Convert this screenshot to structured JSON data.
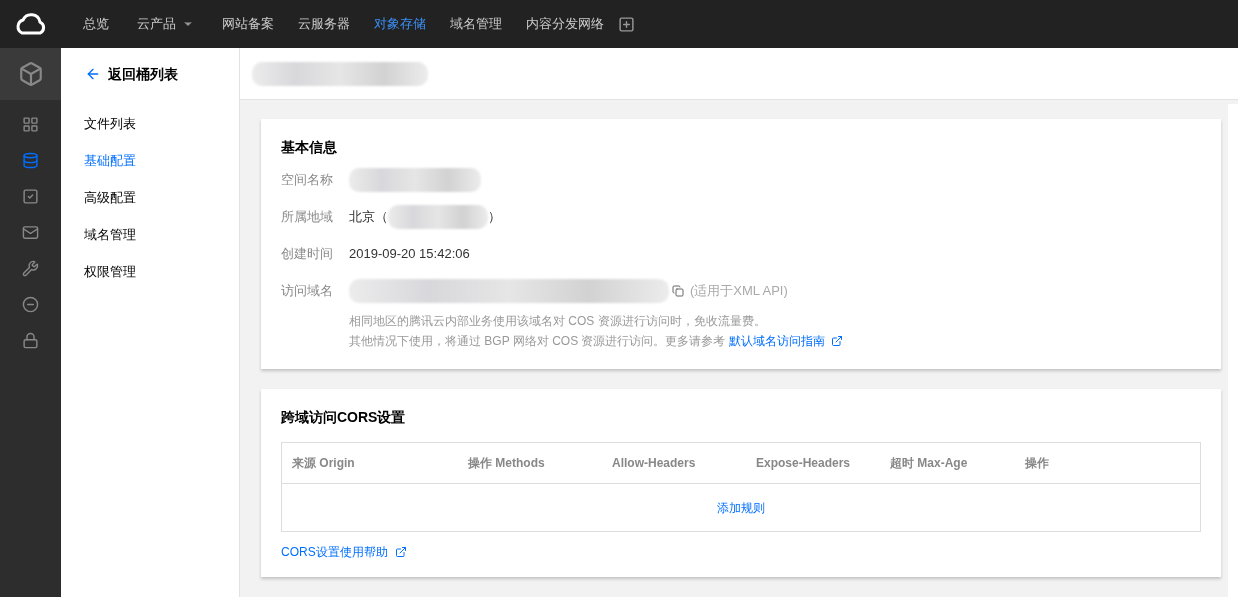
{
  "top_nav": [
    {
      "label": "总览",
      "selected": false,
      "dropdown": false
    },
    {
      "label": "云产品",
      "selected": false,
      "dropdown": true
    },
    {
      "label": "网站备案",
      "selected": false,
      "dropdown": false
    },
    {
      "label": "云服务器",
      "selected": false,
      "dropdown": false
    },
    {
      "label": "对象存储",
      "selected": true,
      "dropdown": false
    },
    {
      "label": "域名管理",
      "selected": false,
      "dropdown": false
    },
    {
      "label": "内容分发网络",
      "selected": false,
      "dropdown": false
    }
  ],
  "rail": [
    {
      "kind": "grid",
      "selected": false
    },
    {
      "kind": "database",
      "selected": true
    },
    {
      "kind": "check",
      "selected": false
    },
    {
      "kind": "mail",
      "selected": false
    },
    {
      "kind": "wrench",
      "selected": false
    },
    {
      "kind": "minus",
      "selected": false
    },
    {
      "kind": "lock",
      "selected": false
    }
  ],
  "sidebar": {
    "back": "返回桶列表",
    "items": [
      {
        "label": "文件列表",
        "selected": false
      },
      {
        "label": "基础配置",
        "selected": true
      },
      {
        "label": "高级配置",
        "selected": false
      },
      {
        "label": "域名管理",
        "selected": false
      },
      {
        "label": "权限管理",
        "selected": false
      }
    ]
  },
  "basic_info": {
    "title": "基本信息",
    "fields": [
      {
        "label": "空间名称",
        "kind": "hidden"
      },
      {
        "label": "所属地域",
        "kind": "region",
        "prefix": "北京（",
        "suffix": "）"
      },
      {
        "label": "创建时间",
        "kind": "text",
        "value": "2019-09-20 15:42:06"
      },
      {
        "label": "访问域名",
        "kind": "domain",
        "note": "(适用于XML API)"
      }
    ],
    "hint_lines": [
      "相同地区的腾讯云内部业务使用该域名对 COS 资源进行访问时，免收流量费。",
      "其他情况下使用，将通过 BGP 网络对 COS 资源进行访问。更多请参考"
    ],
    "hint_link": "默认域名访问指南"
  },
  "cors": {
    "title": "跨域访问CORS设置",
    "columns": [
      "来源 Origin",
      "操作 Methods",
      "Allow-Headers",
      "Expose-Headers",
      "超时 Max-Age",
      "操作"
    ],
    "add_rule": "添加规则",
    "help_link": "CORS设置使用帮助"
  }
}
